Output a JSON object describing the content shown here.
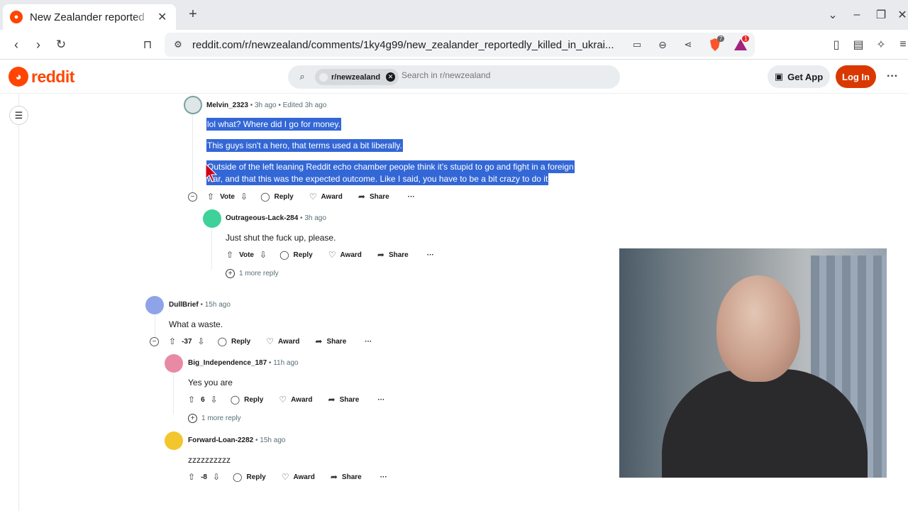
{
  "browser": {
    "tab_title": "New Zealander reported",
    "tab_close": "✕",
    "new_tab": "+",
    "url": "reddit.com/r/newzealand/comments/1ky4g99/new_zealander_reportedly_killed_in_ukrai...",
    "brave_count": "7",
    "alert_count": "1"
  },
  "header": {
    "logo_text": "reddit",
    "subreddit_chip": "r/newzealand",
    "search_placeholder": "Search in r/newzealand",
    "get_app": "Get App",
    "login": "Log In",
    "more": "···"
  },
  "comments": [
    {
      "user": "Melvin_2323",
      "meta": " • 3h ago • Edited 3h ago",
      "lines": [
        "lol what? Where did I go for money.",
        "This guys isn't a hero, that terms used a bit liberally.",
        "Outside of the left leaning Reddit echo chamber people think it's stupid to go and fight in a foreign",
        "war, and that this was the expected outcome. Like I said, you have to be a bit crazy to do it"
      ],
      "vote": "Vote",
      "reply": "Reply",
      "award": "Award",
      "share": "Share",
      "dots": "···"
    },
    {
      "user": "Outrageous-Lack-284",
      "meta": " • 3h ago",
      "text": "Just shut the fuck up, please.",
      "vote": "Vote",
      "reply": "Reply",
      "award": "Award",
      "share": "Share",
      "dots": "···",
      "more_replies": "1 more reply"
    },
    {
      "user": "DullBrief",
      "meta": " • 15h ago",
      "text": "What a waste.",
      "vote": "-37",
      "reply": "Reply",
      "award": "Award",
      "share": "Share",
      "dots": "···"
    },
    {
      "user": "Big_Independence_187",
      "meta": " • 11h ago",
      "text": "Yes you are",
      "vote": "6",
      "reply": "Reply",
      "award": "Award",
      "share": "Share",
      "dots": "···",
      "more_replies": "1 more reply"
    },
    {
      "user": "Forward-Loan-2282",
      "meta": " • 15h ago",
      "text": "zzzzzzzzzz",
      "vote": "-8",
      "reply": "Reply",
      "award": "Award",
      "share": "Share",
      "dots": "···"
    }
  ],
  "colors": {
    "brand": "#ff4500",
    "login_bg": "#d93900",
    "selection": "#3367d6"
  }
}
